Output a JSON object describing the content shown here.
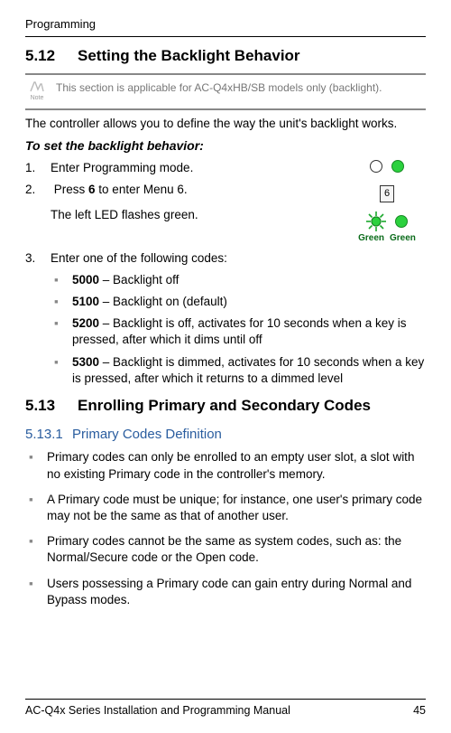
{
  "header": {
    "label": "Programming"
  },
  "sec512": {
    "num": "5.12",
    "title": "Setting the Backlight Behavior"
  },
  "note": {
    "iconLabel": "Note",
    "text": "This section is applicable for AC-Q4xHB/SB models only (backlight)."
  },
  "intro": "The controller allows you to define the way the unit's backlight works.",
  "procTitle": "To set the backlight behavior:",
  "steps": {
    "s1": {
      "n": "1.",
      "text": "Enter Programming mode."
    },
    "s2a": {
      "n": "2.",
      "text_pre": "Press ",
      "bold": "6",
      "text_post": " to enter Menu 6."
    },
    "s2b": "The left LED flashes green.",
    "keypad": "6",
    "ledLabels": {
      "left": "Green",
      "right": "Green"
    },
    "s3": {
      "n": "3.",
      "text": "Enter one of the following codes:"
    }
  },
  "codes": [
    {
      "code": "5000",
      "desc": " – Backlight off"
    },
    {
      "code": "5100",
      "desc": " – Backlight on (default)"
    },
    {
      "code": "5200",
      "desc": " – Backlight is off, activates for 10 seconds when a key is pressed, after which it dims until off"
    },
    {
      "code": "5300",
      "desc": " – Backlight is dimmed, activates for 10 seconds when a key is pressed, after which it returns to a dimmed level"
    }
  ],
  "sec513": {
    "num": "5.13",
    "title": "Enrolling Primary and Secondary Codes"
  },
  "sec5131": {
    "num": "5.13.1",
    "title": "Primary Codes Definition"
  },
  "primaryBullets": [
    "Primary codes can only be enrolled to an empty user slot, a slot with no existing Primary code in the controller's memory.",
    "A Primary code must be unique; for instance, one user's primary code may not be the same as that of another user.",
    "Primary codes cannot be the same as system codes, such as: the Normal/Secure code or the Open code.",
    "Users possessing a Primary code can gain entry during Normal and Bypass modes."
  ],
  "footer": {
    "left": "AC-Q4x Series Installation and Programming Manual",
    "right": "45"
  }
}
